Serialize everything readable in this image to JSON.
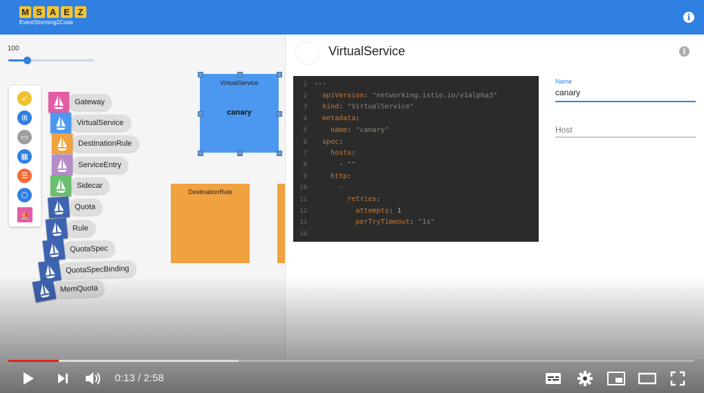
{
  "app": {
    "logo_letters": [
      "M",
      "S",
      "A",
      "E",
      "Z"
    ],
    "logo_subtitle": "EventStorming2Code",
    "brand_color": "#2f80e1"
  },
  "canvas": {
    "zoom_value": "100",
    "zoom_fraction": 0.22
  },
  "palette": [
    {
      "icon": "rocket-icon",
      "color": "#f2c12e"
    },
    {
      "icon": "sitemap-icon",
      "color": "#2f80e1"
    },
    {
      "icon": "server-icon",
      "color": "#9e9e9e"
    },
    {
      "icon": "grid-icon",
      "color": "#2f80e1"
    },
    {
      "icon": "list-icon",
      "color": "#f26b3a"
    },
    {
      "icon": "shield-icon",
      "color": "#2f80e1"
    },
    {
      "icon": "istio-icon",
      "color": "#e35da4"
    }
  ],
  "component_list": [
    {
      "label": "Gateway",
      "color": "#e35da4"
    },
    {
      "label": "VirtualService",
      "color": "#4c98f0"
    },
    {
      "label": "DestinationRule",
      "color": "#f0a140"
    },
    {
      "label": "ServiceEntry",
      "color": "#b58cc7"
    },
    {
      "label": "Sidecar",
      "color": "#6abf6e"
    },
    {
      "label": "Quota",
      "color": "#3e63b0"
    },
    {
      "label": "Rule",
      "color": "#3e63b0"
    },
    {
      "label": "QuotaSpec",
      "color": "#3e63b0"
    },
    {
      "label": "QuotaSpecBinding",
      "color": "#3e63b0"
    },
    {
      "label": "MemQuota",
      "color": "#3e63b0"
    }
  ],
  "nodes": {
    "virtual_service": {
      "type_label": "VirtualService",
      "name": "canary"
    },
    "destination_rule": {
      "type_label": "DestinationRule"
    }
  },
  "panel": {
    "title": "VirtualService",
    "code_lines": [
      {
        "n": "1",
        "parts": [
          {
            "c": "punc",
            "t": "---"
          }
        ]
      },
      {
        "n": "2",
        "parts": [
          {
            "c": "key",
            "t": "  apiVersion"
          },
          {
            "c": "punc",
            "t": ": "
          },
          {
            "c": "str",
            "t": "\"networking.istio.io/v1alpha3\""
          }
        ]
      },
      {
        "n": "3",
        "parts": [
          {
            "c": "key",
            "t": "  kind"
          },
          {
            "c": "punc",
            "t": ": "
          },
          {
            "c": "str",
            "t": "\"VirtualService\""
          }
        ]
      },
      {
        "n": "4",
        "parts": [
          {
            "c": "key",
            "t": "  metadata"
          },
          {
            "c": "punc",
            "t": ":"
          }
        ]
      },
      {
        "n": "5",
        "parts": [
          {
            "c": "key",
            "t": "    name"
          },
          {
            "c": "punc",
            "t": ": "
          },
          {
            "c": "str",
            "t": "\"canary\""
          }
        ]
      },
      {
        "n": "6",
        "parts": [
          {
            "c": "key",
            "t": "  spec"
          },
          {
            "c": "punc",
            "t": ":"
          }
        ]
      },
      {
        "n": "7",
        "parts": [
          {
            "c": "key",
            "t": "    hosts"
          },
          {
            "c": "punc",
            "t": ":"
          }
        ]
      },
      {
        "n": "8",
        "parts": [
          {
            "c": "punc",
            "t": "      - "
          },
          {
            "c": "str",
            "t": "\"\""
          }
        ]
      },
      {
        "n": "9",
        "parts": [
          {
            "c": "key",
            "t": "    http"
          },
          {
            "c": "punc",
            "t": ":"
          }
        ]
      },
      {
        "n": "10",
        "parts": [
          {
            "c": "key",
            "t": "      -"
          }
        ]
      },
      {
        "n": "11",
        "parts": [
          {
            "c": "key",
            "t": "        retries"
          },
          {
            "c": "punc",
            "t": ":"
          }
        ]
      },
      {
        "n": "12",
        "parts": [
          {
            "c": "key",
            "t": "          attempts"
          },
          {
            "c": "punc",
            "t": ": "
          },
          {
            "c": "num",
            "t": "1"
          }
        ]
      },
      {
        "n": "13",
        "parts": [
          {
            "c": "key",
            "t": "          perTryTimeout"
          },
          {
            "c": "punc",
            "t": ": "
          },
          {
            "c": "str",
            "t": "\"1s\""
          }
        ]
      },
      {
        "n": "14",
        "parts": []
      }
    ],
    "name_label": "Name",
    "name_value": "canary",
    "host_label": "Host"
  },
  "player": {
    "current_time": "0:13",
    "separator": " / ",
    "duration": "2:58",
    "played_fraction": 0.074,
    "buffered_fraction": 0.336
  }
}
